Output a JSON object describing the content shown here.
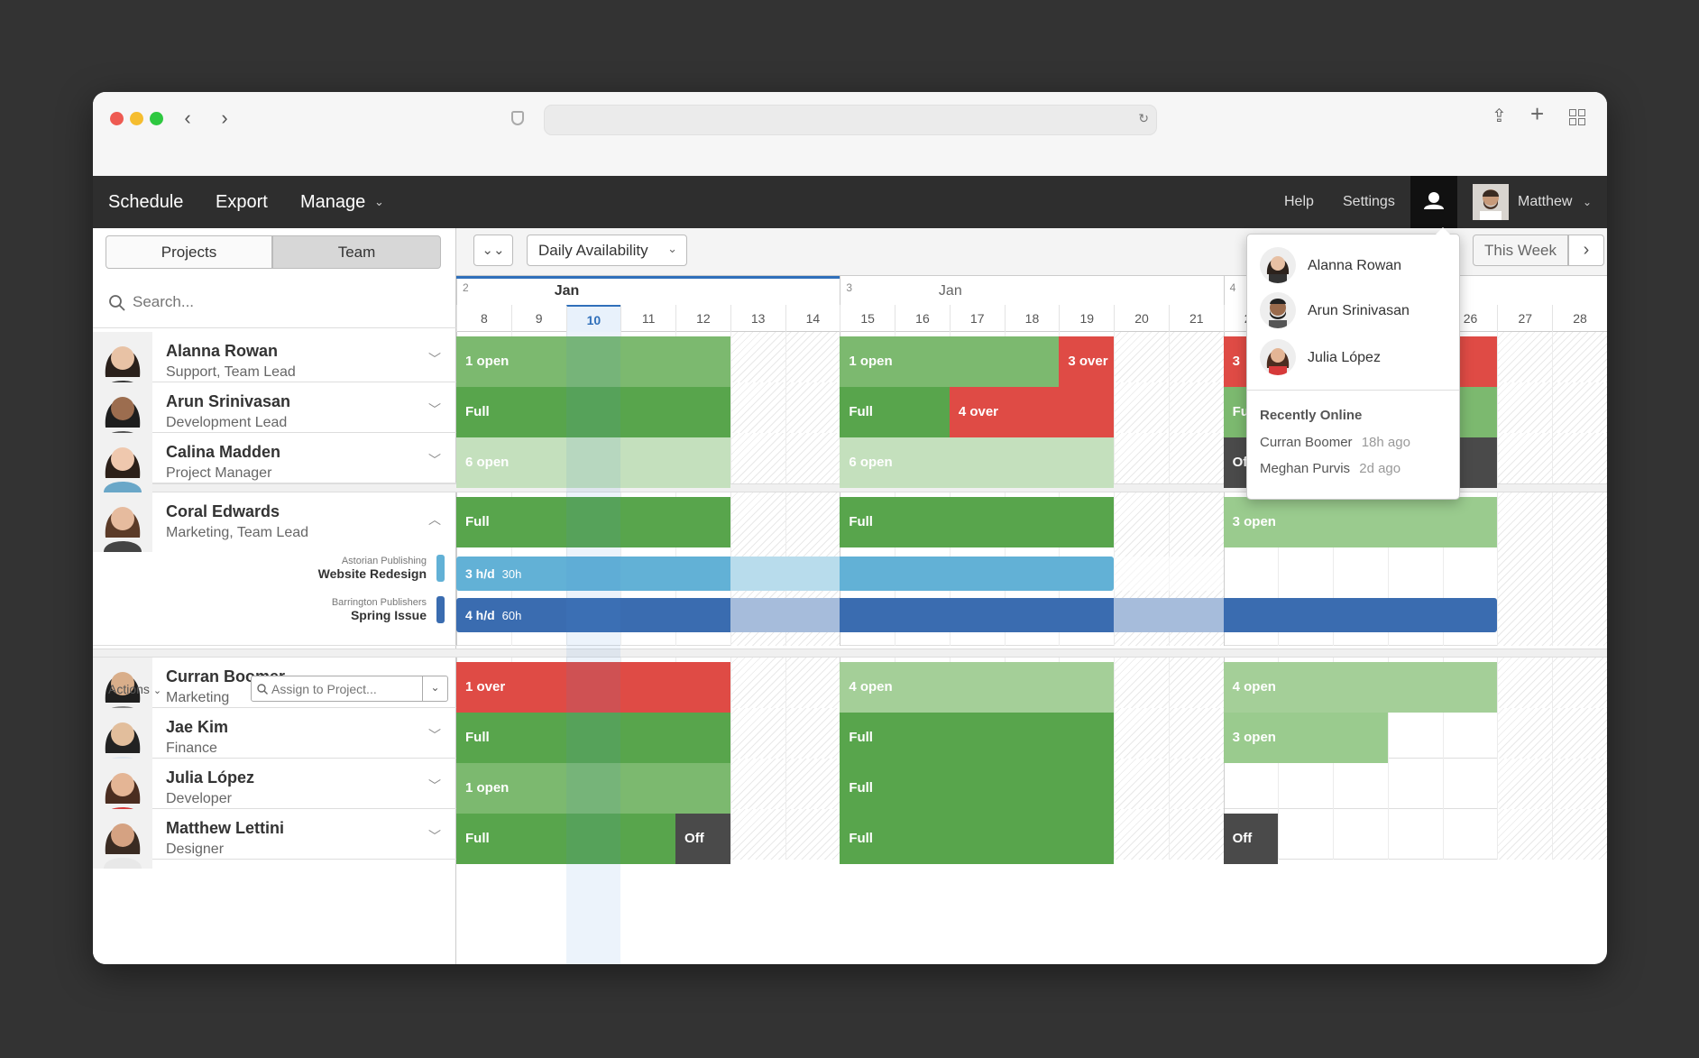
{
  "browser": {
    "traffic_lights": [
      "#ee5a52",
      "#f5bd2f",
      "#2ec840"
    ]
  },
  "nav": {
    "schedule": "Schedule",
    "export": "Export",
    "manage": "Manage",
    "help": "Help",
    "settings": "Settings",
    "user": "Matthew"
  },
  "toggle": {
    "projects": "Projects",
    "team": "Team"
  },
  "search": {
    "placeholder": "Search..."
  },
  "toolbar": {
    "availability": "Daily Availability",
    "this_week": "This Week"
  },
  "calendar": {
    "weeks": [
      {
        "num": "2",
        "month": "Jan"
      },
      {
        "num": "3",
        "month": "Jan"
      },
      {
        "num": "4"
      }
    ],
    "days": [
      "8",
      "9",
      "10",
      "11",
      "12",
      "13",
      "14",
      "15",
      "16",
      "17",
      "18",
      "19",
      "20",
      "21",
      "22",
      "23",
      "24",
      "25",
      "26",
      "27",
      "28"
    ],
    "today": "10"
  },
  "people": [
    {
      "name": "Alanna Rowan",
      "role": "Support, Team Lead"
    },
    {
      "name": "Arun Srinivasan",
      "role": "Development Lead"
    },
    {
      "name": "Calina Madden",
      "role": "Project Manager"
    },
    {
      "name": "Coral Edwards",
      "role": "Marketing, Team Lead"
    },
    {
      "name": "Curran Boomer",
      "role": "Marketing"
    },
    {
      "name": "Jae Kim",
      "role": "Finance"
    },
    {
      "name": "Julia López",
      "role": "Developer"
    },
    {
      "name": "Matthew Lettini",
      "role": "Designer"
    }
  ],
  "assignments": [
    {
      "client": "Astorian Publishing",
      "project": "Website Redesign",
      "hours": "3 h/d",
      "total": "30h"
    },
    {
      "client": "Barrington Publishers",
      "project": "Spring Issue",
      "hours": "4 h/d",
      "total": "60h"
    }
  ],
  "actions": {
    "label": "Actions",
    "assign_placeholder": "Assign to Project..."
  },
  "bars": {
    "alanna": [
      "1 open",
      "1 open",
      "3 over",
      "3"
    ],
    "arun": [
      "Full",
      "Full",
      "4 over",
      "Fu"
    ],
    "calina": [
      "6 open",
      "6 open",
      "Of"
    ],
    "coral": [
      "Full",
      "Full",
      "3 open"
    ],
    "curran": [
      "1 over",
      "4 open",
      "4 open"
    ],
    "jae": [
      "Full",
      "Full",
      "3 open"
    ],
    "julia": [
      "1 open",
      "Full"
    ],
    "matthew": [
      "Full",
      "Off",
      "Full",
      "Off"
    ]
  },
  "dropdown": {
    "online": [
      "Alanna Rowan",
      "Arun Srinivasan",
      "Julia López"
    ],
    "recent_title": "Recently Online",
    "recent": [
      {
        "name": "Curran Boomer",
        "ago": "18h ago"
      },
      {
        "name": "Meghan Purvis",
        "ago": "2d ago"
      }
    ]
  },
  "colors": {
    "full": "#58a54c",
    "open_light": "#c4e0bd",
    "open_mid": "#7cb96f",
    "over": "#df4b45",
    "off": "#4a4a4a",
    "project_light": "#62b1d6",
    "project_dark": "#3a6cb0"
  }
}
